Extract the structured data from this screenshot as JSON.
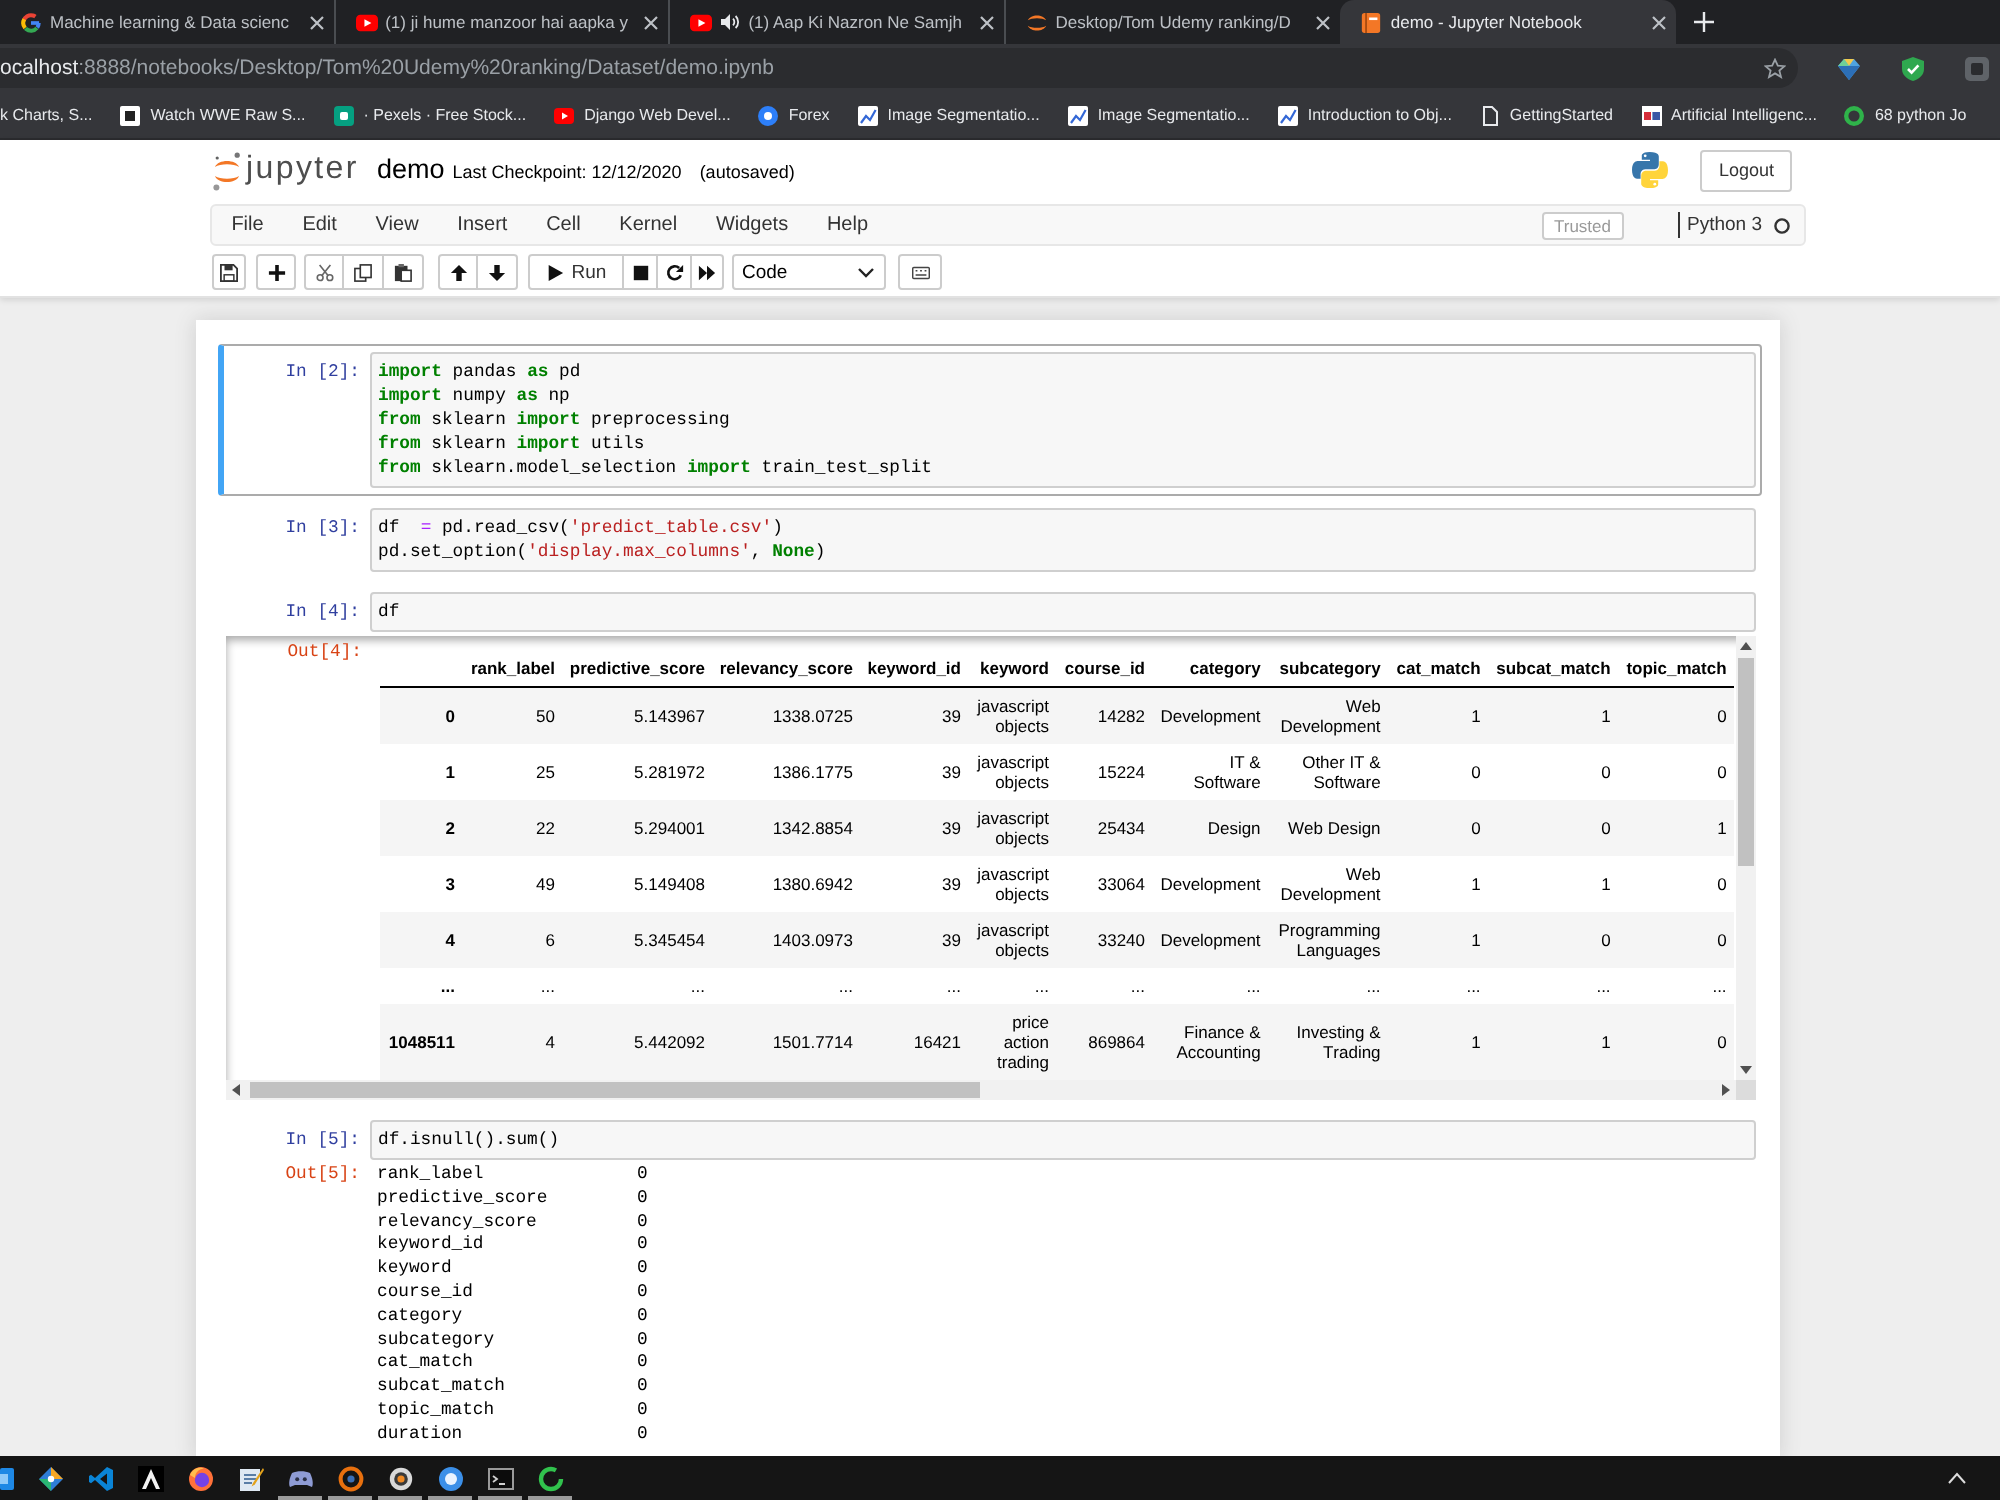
{
  "browser": {
    "tabs": [
      {
        "title": "Machine learning & Data scienc",
        "kind": "ring",
        "selected": false,
        "audio": false
      },
      {
        "title": "(1) ji hume manzoor hai aapka y",
        "kind": "play",
        "selected": false,
        "audio": false
      },
      {
        "title": "(1) Aap Ki Nazron Ne Samjh",
        "kind": "play",
        "selected": false,
        "audio": true
      },
      {
        "title": "Desktop/Tom Udemy ranking/D",
        "kind": "orbit",
        "selected": false,
        "audio": false
      },
      {
        "title": "demo - Jupyter Notebook",
        "kind": "book",
        "selected": true,
        "audio": false
      }
    ],
    "address": {
      "host": "ocalhost",
      "path": ":8888/notebooks/Desktop/Tom%20Udemy%20ranking/Dataset/demo.ipynb"
    },
    "bookmarks": [
      {
        "label": "k Charts, S...",
        "kind": "none"
      },
      {
        "label": "Watch WWE Raw S...",
        "kind": "page"
      },
      {
        "label": "· Pexels · Free Stock...",
        "kind": "tile"
      },
      {
        "label": "Django Web Devel...",
        "kind": "play"
      },
      {
        "label": "Forex",
        "kind": "circle"
      },
      {
        "label": "Image Segmentatio...",
        "kind": "chart"
      },
      {
        "label": "Image Segmentatio...",
        "kind": "chart"
      },
      {
        "label": "Introduction to Obj...",
        "kind": "chart"
      },
      {
        "label": "GettingStarted",
        "kind": "document"
      },
      {
        "label": "Artificial Intelligenc...",
        "kind": "label"
      },
      {
        "label": "68 python Jo",
        "kind": "ring"
      }
    ]
  },
  "notebook": {
    "logo_text": "jupyter",
    "name": "demo",
    "checkpoint": "Last Checkpoint: 12/12/2020",
    "autosave": "(autosaved)",
    "logout": "Logout"
  },
  "menu": {
    "items": [
      "File",
      "Edit",
      "View",
      "Insert",
      "Cell",
      "Kernel",
      "Widgets",
      "Help"
    ],
    "trusted": "Trusted",
    "kernel": "Python 3",
    "kernel_busy": false
  },
  "toolbar": {
    "run": "Run",
    "cell_type": "Code"
  },
  "cells": [
    {
      "prompt": "In [2]:",
      "selected": true,
      "code": [
        [
          {
            "kind": "keyword",
            "text": "import"
          },
          {
            "kind": "plain",
            "text": " pandas "
          },
          {
            "kind": "keyword",
            "text": "as"
          },
          {
            "kind": "plain",
            "text": " pd"
          }
        ],
        [
          {
            "kind": "keyword",
            "text": "import"
          },
          {
            "kind": "plain",
            "text": " numpy "
          },
          {
            "kind": "keyword",
            "text": "as"
          },
          {
            "kind": "plain",
            "text": " np"
          }
        ],
        [
          {
            "kind": "keyword",
            "text": "from"
          },
          {
            "kind": "plain",
            "text": " sklearn "
          },
          {
            "kind": "keyword",
            "text": "import"
          },
          {
            "kind": "plain",
            "text": " preprocessing"
          }
        ],
        [
          {
            "kind": "keyword",
            "text": "from"
          },
          {
            "kind": "plain",
            "text": " sklearn "
          },
          {
            "kind": "keyword",
            "text": "import"
          },
          {
            "kind": "plain",
            "text": " utils"
          }
        ],
        [
          {
            "kind": "keyword",
            "text": "from"
          },
          {
            "kind": "plain",
            "text": " sklearn.model_selection "
          },
          {
            "kind": "keyword",
            "text": "import"
          },
          {
            "kind": "plain",
            "text": " train_test_split"
          }
        ]
      ]
    },
    {
      "prompt": "In [3]:",
      "selected": false,
      "code": [
        [
          {
            "kind": "plain",
            "text": "df  "
          },
          {
            "kind": "operator",
            "text": "="
          },
          {
            "kind": "plain",
            "text": " pd.read_csv("
          },
          {
            "kind": "string",
            "text": "'predict_table.csv'"
          },
          {
            "kind": "plain",
            "text": ")"
          }
        ],
        [
          {
            "kind": "plain",
            "text": "pd.set_option("
          },
          {
            "kind": "string",
            "text": "'display.max_columns'"
          },
          {
            "kind": "plain",
            "text": ", "
          },
          {
            "kind": "keyword",
            "text": "None"
          },
          {
            "kind": "plain",
            "text": ")"
          }
        ]
      ]
    },
    {
      "prompt": "In [4]:",
      "selected": false,
      "code": [
        [
          {
            "kind": "plain",
            "text": "df"
          }
        ]
      ],
      "output": {
        "kind": "dataframe",
        "prompt": "Out[4]:",
        "columns": [
          "rank_label",
          "predictive_score",
          "relevancy_score",
          "keyword_id",
          "keyword",
          "course_id",
          "category",
          "subcategory",
          "cat_match",
          "subcat_match",
          "topic_match"
        ],
        "rows": [
          {
            "index": "0",
            "cells": [
              "50",
              "5.143967",
              "1338.0725",
              "39",
              "javascript objects",
              "14282",
              "Development",
              "Web Development",
              "1",
              "1",
              "0"
            ]
          },
          {
            "index": "1",
            "cells": [
              "25",
              "5.281972",
              "1386.1775",
              "39",
              "javascript objects",
              "15224",
              "IT & Software",
              "Other IT & Software",
              "0",
              "0",
              "0"
            ]
          },
          {
            "index": "2",
            "cells": [
              "22",
              "5.294001",
              "1342.8854",
              "39",
              "javascript objects",
              "25434",
              "Design",
              "Web Design",
              "0",
              "0",
              "1"
            ]
          },
          {
            "index": "3",
            "cells": [
              "49",
              "5.149408",
              "1380.6942",
              "39",
              "javascript objects",
              "33064",
              "Development",
              "Web Development",
              "1",
              "1",
              "0"
            ]
          },
          {
            "index": "4",
            "cells": [
              "6",
              "5.345454",
              "1403.0973",
              "39",
              "javascript objects",
              "33240",
              "Development",
              "Programming Languages",
              "1",
              "0",
              "0"
            ]
          },
          {
            "index": "...",
            "cells": [
              "...",
              "...",
              "...",
              "...",
              "...",
              "...",
              "...",
              "...",
              "...",
              "...",
              "..."
            ]
          },
          {
            "index": "1048511",
            "cells": [
              "4",
              "5.442092",
              "1501.7714",
              "16421",
              "price action trading",
              "869864",
              "Finance & Accounting",
              "Investing & Trading",
              "1",
              "1",
              "0"
            ]
          }
        ]
      }
    },
    {
      "prompt": "In [5]:",
      "selected": false,
      "code": [
        [
          {
            "kind": "plain",
            "text": "df.isnull().sum()"
          }
        ]
      ],
      "output": {
        "kind": "series",
        "prompt": "Out[5]:",
        "rows": [
          {
            "label": "rank_label",
            "value": "0"
          },
          {
            "label": "predictive_score",
            "value": "0"
          },
          {
            "label": "relevancy_score",
            "value": "0"
          },
          {
            "label": "keyword_id",
            "value": "0"
          },
          {
            "label": "keyword",
            "value": "0"
          },
          {
            "label": "course_id",
            "value": "0"
          },
          {
            "label": "category",
            "value": "0"
          },
          {
            "label": "subcategory",
            "value": "0"
          },
          {
            "label": "cat_match",
            "value": "0"
          },
          {
            "label": "subcat_match",
            "value": "0"
          },
          {
            "label": "topic_match",
            "value": "0"
          },
          {
            "label": "duration",
            "value": "0"
          }
        ]
      }
    }
  ],
  "taskbar": {
    "apps": [
      {
        "kind": "tile",
        "running": false
      },
      {
        "kind": "diamond",
        "running": false
      },
      {
        "kind": "ribbon",
        "running": false
      },
      {
        "kind": "emblem",
        "running": false
      },
      {
        "kind": "globe",
        "running": false
      },
      {
        "kind": "notepad",
        "running": false
      },
      {
        "kind": "gamepad",
        "running": true
      },
      {
        "kind": "target",
        "running": true
      },
      {
        "kind": "aperture",
        "running": true
      },
      {
        "kind": "circle",
        "running": true
      },
      {
        "kind": "terminal",
        "running": true
      },
      {
        "kind": "ring",
        "running": true
      }
    ]
  }
}
